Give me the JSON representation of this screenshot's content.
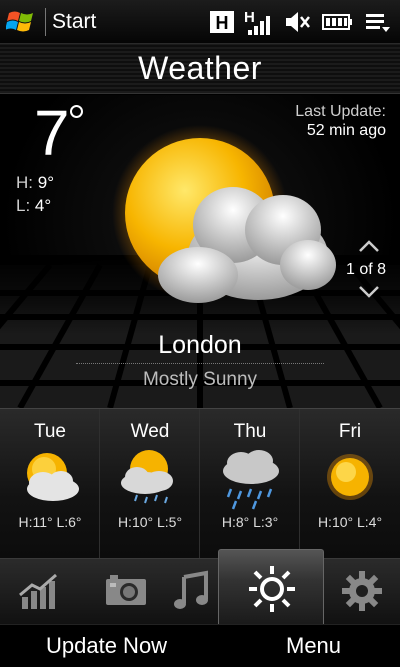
{
  "status_bar": {
    "title": "Start",
    "icons": [
      "windows-logo-icon",
      "h-network-icon",
      "signal-strength-icon",
      "volume-mute-icon",
      "battery-icon",
      "notifications-icon"
    ],
    "network_letter": "H"
  },
  "header": {
    "title": "Weather"
  },
  "current": {
    "temperature": "7",
    "high_label": "H:",
    "high": "9°",
    "low_label": "L:",
    "low": "4°",
    "last_update_label": "Last Update:",
    "last_update_value": "52 min ago",
    "icon": "sun-behind-cloud-icon",
    "city": "London",
    "condition": "Mostly Sunny",
    "pager": "1 of 8"
  },
  "forecast": [
    {
      "day": "Tue",
      "icon": "partly-cloudy-icon",
      "temps": "H:11° L:6°"
    },
    {
      "day": "Wed",
      "icon": "sun-cloud-drizzle-icon",
      "temps": "H:10° L:5°"
    },
    {
      "day": "Thu",
      "icon": "rain-icon",
      "temps": "H:8° L:3°"
    },
    {
      "day": "Fri",
      "icon": "sunny-icon",
      "temps": "H:10° L:4°"
    }
  ],
  "tabs": [
    {
      "name": "stocks-tab",
      "icon": "chart-icon"
    },
    {
      "name": "photos-tab",
      "icon": "camera-icon"
    },
    {
      "name": "music-tab",
      "icon": "music-note-icon"
    },
    {
      "name": "weather-tab",
      "icon": "sun-icon",
      "active": true
    },
    {
      "name": "settings-tab",
      "icon": "gear-icon"
    }
  ],
  "softkeys": {
    "left": "Update Now",
    "right": "Menu"
  },
  "colors": {
    "sun": "#f5b800",
    "background": "#000000",
    "text": "#ffffff"
  }
}
